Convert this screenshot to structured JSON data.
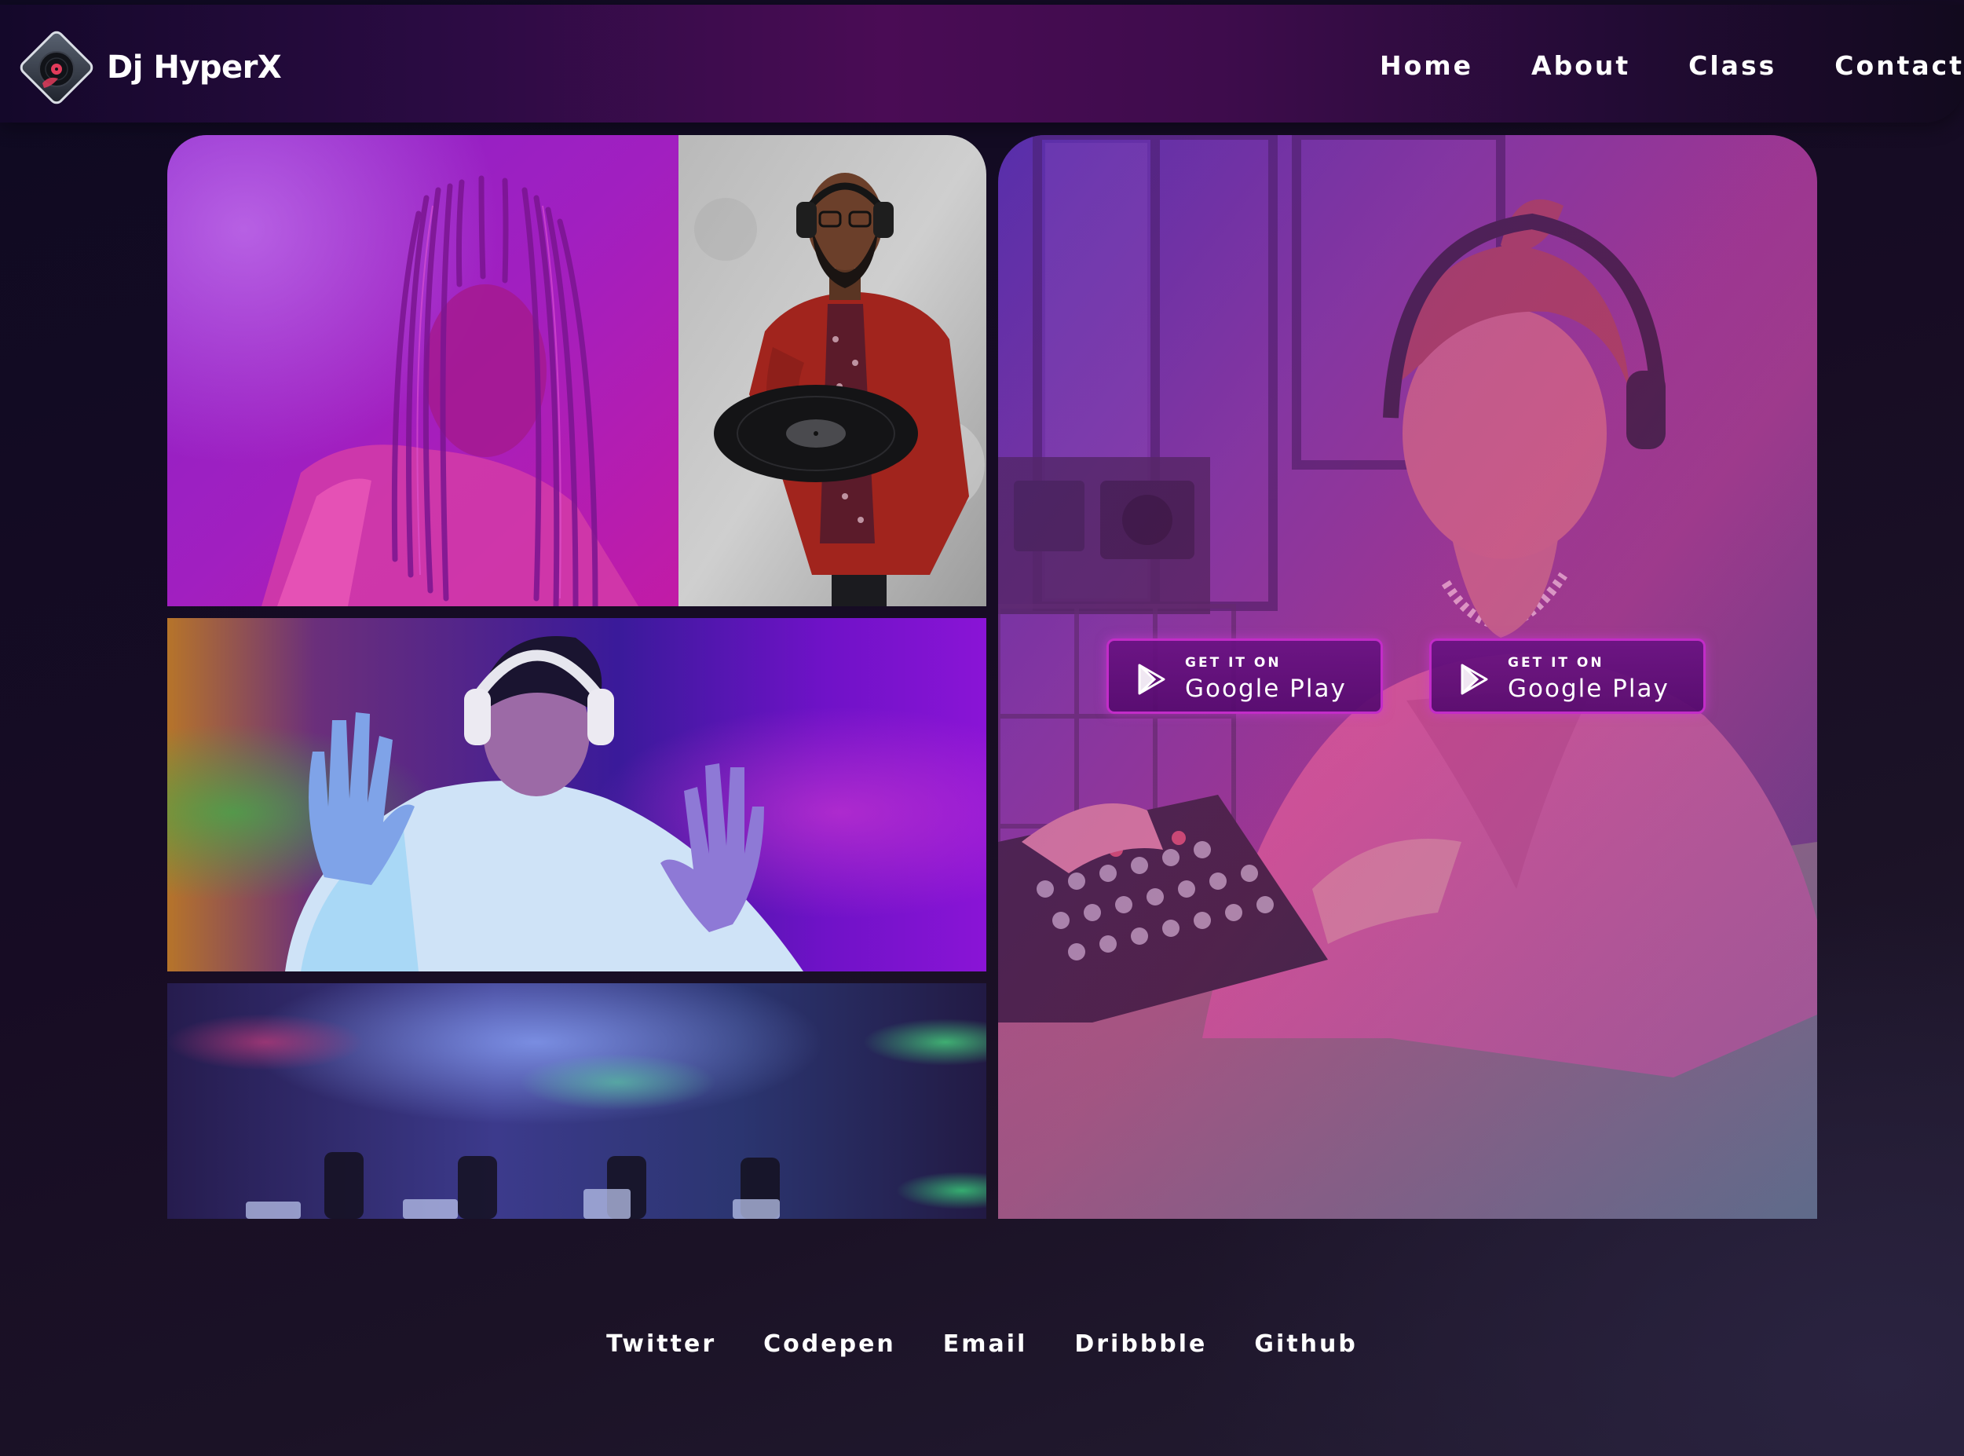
{
  "header": {
    "brand": "Dj HyperX",
    "logo_icon": "vinyl-disc-logo-icon",
    "nav": [
      {
        "label": "Home"
      },
      {
        "label": "About"
      },
      {
        "label": "Class"
      },
      {
        "label": "Contact"
      }
    ]
  },
  "gallery": {
    "photos": [
      {
        "icon": "photo-woman-braids-purple-light"
      },
      {
        "icon": "photo-man-headphones-holding-vinyl"
      },
      {
        "icon": "photo-man-headphones-dancing"
      },
      {
        "icon": "photo-blurred-mixer-knobs"
      },
      {
        "icon": "photo-woman-headphones-at-mixer"
      }
    ]
  },
  "store_buttons": [
    {
      "small": "GET IT ON",
      "big": "Google Play",
      "icon": "google-play-icon"
    },
    {
      "small": "GET IT ON",
      "big": "Google Play",
      "icon": "google-play-icon"
    }
  ],
  "footer": {
    "links": [
      {
        "label": "Twitter"
      },
      {
        "label": "Codepen"
      },
      {
        "label": "Email"
      },
      {
        "label": "Dribbble"
      },
      {
        "label": "Github"
      }
    ]
  },
  "colors": {
    "background": "#150d24",
    "header_gradient_mid": "#4a0c55",
    "button_border": "#c22cc8",
    "button_fill": "#6a1282",
    "text": "#ffffff"
  }
}
